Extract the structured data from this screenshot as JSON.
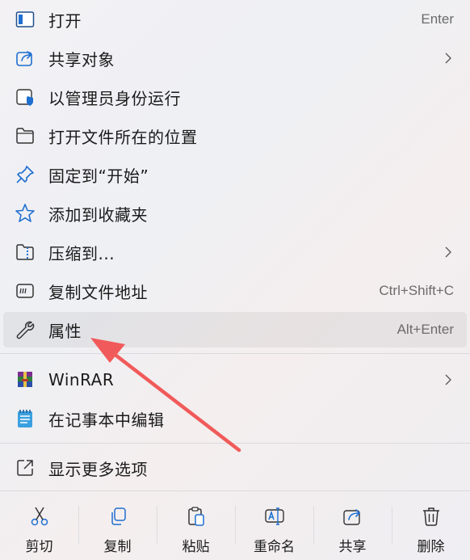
{
  "colors": {
    "accent": "#0067c0",
    "arrow": "#f15a5a"
  },
  "menu": {
    "items": [
      {
        "label": "打开",
        "shortcut": "Enter",
        "icon": "window-open-icon"
      },
      {
        "label": "共享对象",
        "icon": "share-icon",
        "submenu": true
      },
      {
        "label": "以管理员身份运行",
        "icon": "admin-shield-icon"
      },
      {
        "label": "打开文件所在的位置",
        "icon": "folder-icon"
      },
      {
        "label": "固定到“开始”",
        "icon": "pin-icon"
      },
      {
        "label": "添加到收藏夹",
        "icon": "star-icon"
      },
      {
        "label": "压缩到...",
        "icon": "zip-folder-icon",
        "submenu": true
      },
      {
        "label": "复制文件地址",
        "shortcut": "Ctrl+Shift+C",
        "icon": "copy-path-icon"
      },
      {
        "label": "属性",
        "shortcut": "Alt+Enter",
        "icon": "wrench-icon",
        "hovered": true
      }
    ],
    "extra_items": [
      {
        "label": "WinRAR",
        "icon": "winrar-icon",
        "submenu": true
      },
      {
        "label": "在记事本中编辑",
        "icon": "notepad-icon"
      }
    ],
    "more_options": {
      "label": "显示更多选项",
      "icon": "show-more-icon"
    }
  },
  "actions": [
    {
      "label": "剪切",
      "icon": "cut-icon"
    },
    {
      "label": "复制",
      "icon": "copy-icon"
    },
    {
      "label": "粘贴",
      "icon": "paste-icon"
    },
    {
      "label": "重命名",
      "icon": "rename-icon"
    },
    {
      "label": "共享",
      "icon": "share-icon"
    },
    {
      "label": "删除",
      "icon": "delete-icon"
    }
  ]
}
